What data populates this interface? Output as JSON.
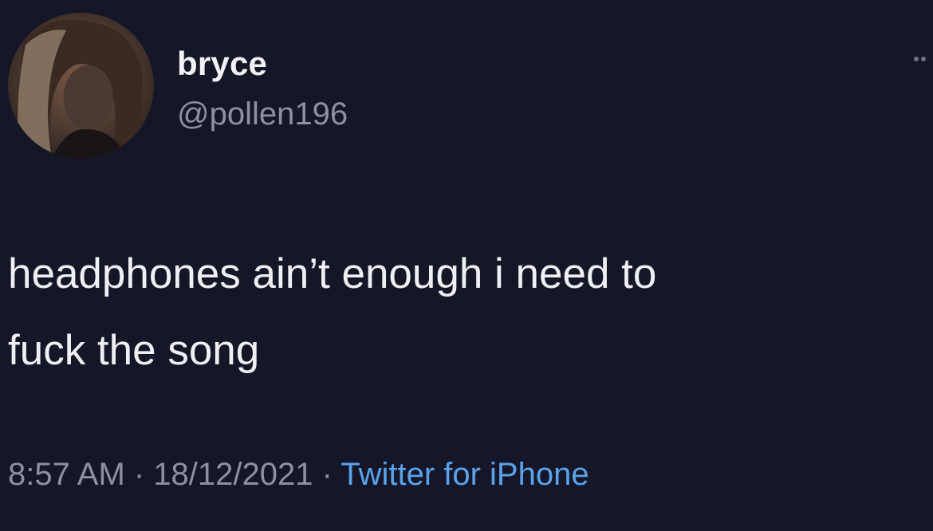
{
  "user": {
    "display_name": "bryce",
    "handle": "@pollen196",
    "avatar_icon": "profile-photo"
  },
  "tweet": {
    "line1": "headphones ain’t enough i need to",
    "line2": "fuck the song"
  },
  "meta": {
    "time": "8:57 AM",
    "separator": " · ",
    "date": "18/12/2021",
    "source": "Twitter for iPhone"
  },
  "colors": {
    "background": "#151729",
    "text": "#f0f0f4",
    "secondary": "#8b90a3",
    "link": "#5aa2ea"
  },
  "icons": {
    "more": "more-options-icon"
  }
}
